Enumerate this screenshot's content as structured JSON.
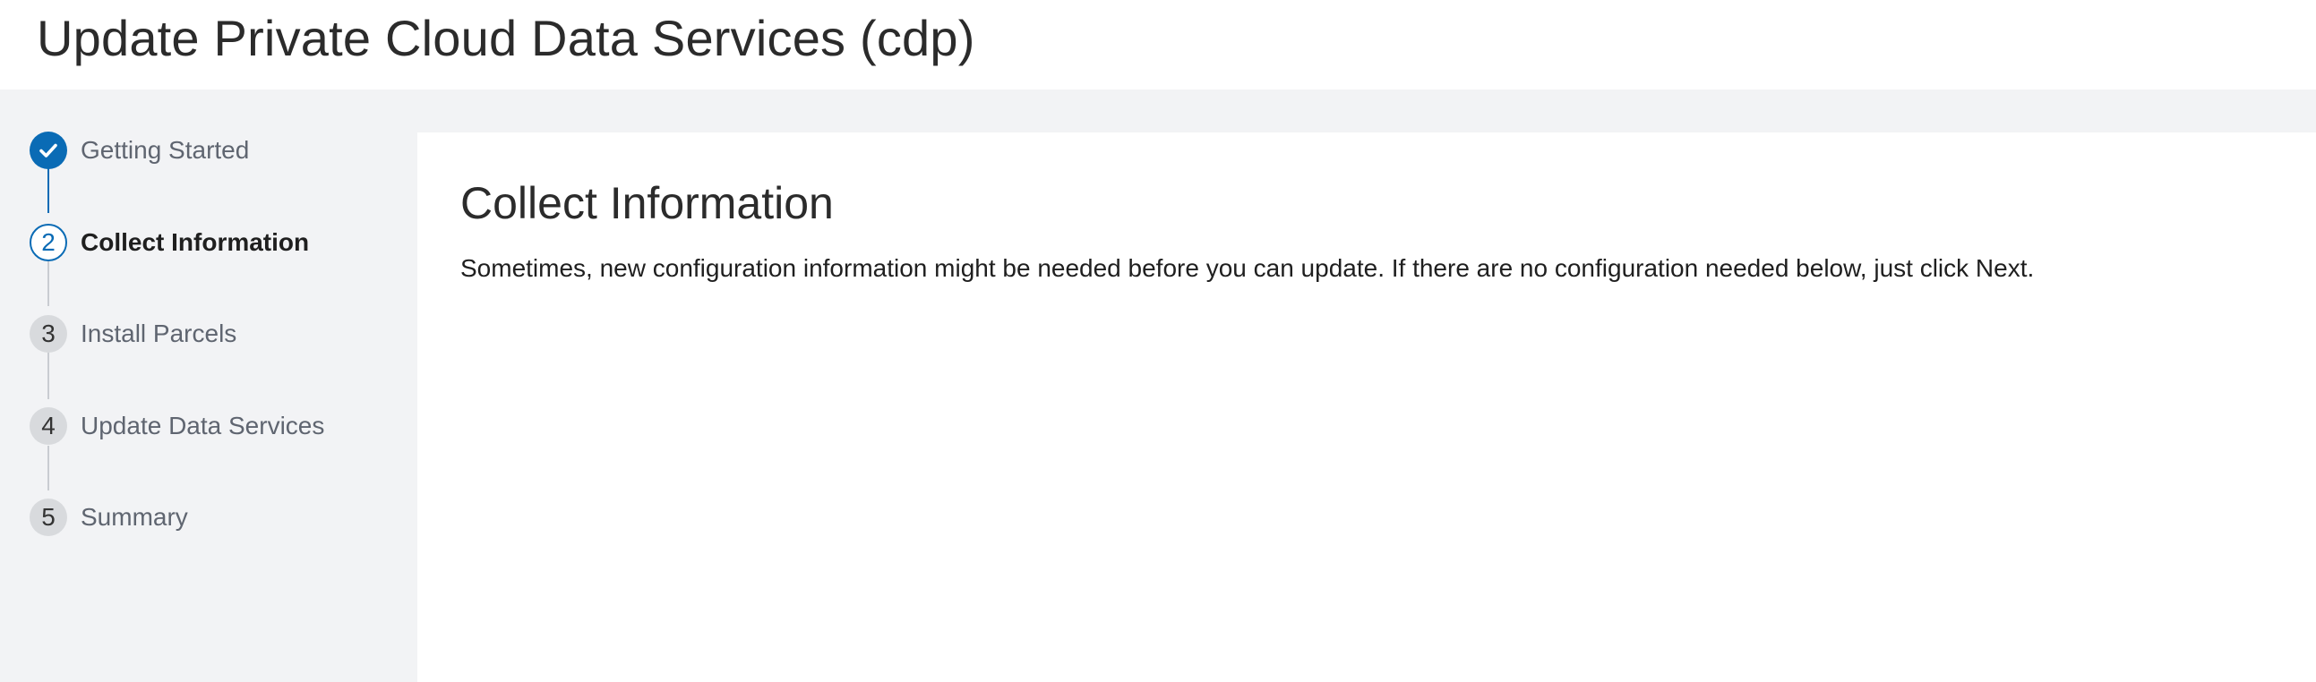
{
  "page": {
    "title": "Update Private Cloud Data Services (cdp)"
  },
  "wizard": {
    "steps": [
      {
        "number": "",
        "label": "Getting Started",
        "state": "complete",
        "icon": "check-icon"
      },
      {
        "number": "2",
        "label": "Collect Information",
        "state": "current"
      },
      {
        "number": "3",
        "label": "Install Parcels",
        "state": "pending"
      },
      {
        "number": "4",
        "label": "Update Data Services",
        "state": "pending"
      },
      {
        "number": "5",
        "label": "Summary",
        "state": "pending"
      }
    ]
  },
  "main": {
    "title": "Collect Information",
    "description": "Sometimes, new configuration information might be needed before you can update. If there are no configuration needed below, just click Next."
  },
  "colors": {
    "accent": "#0a6bb5",
    "sidebar_bg": "#f2f3f5",
    "pending_marker": "#d8dadd"
  }
}
